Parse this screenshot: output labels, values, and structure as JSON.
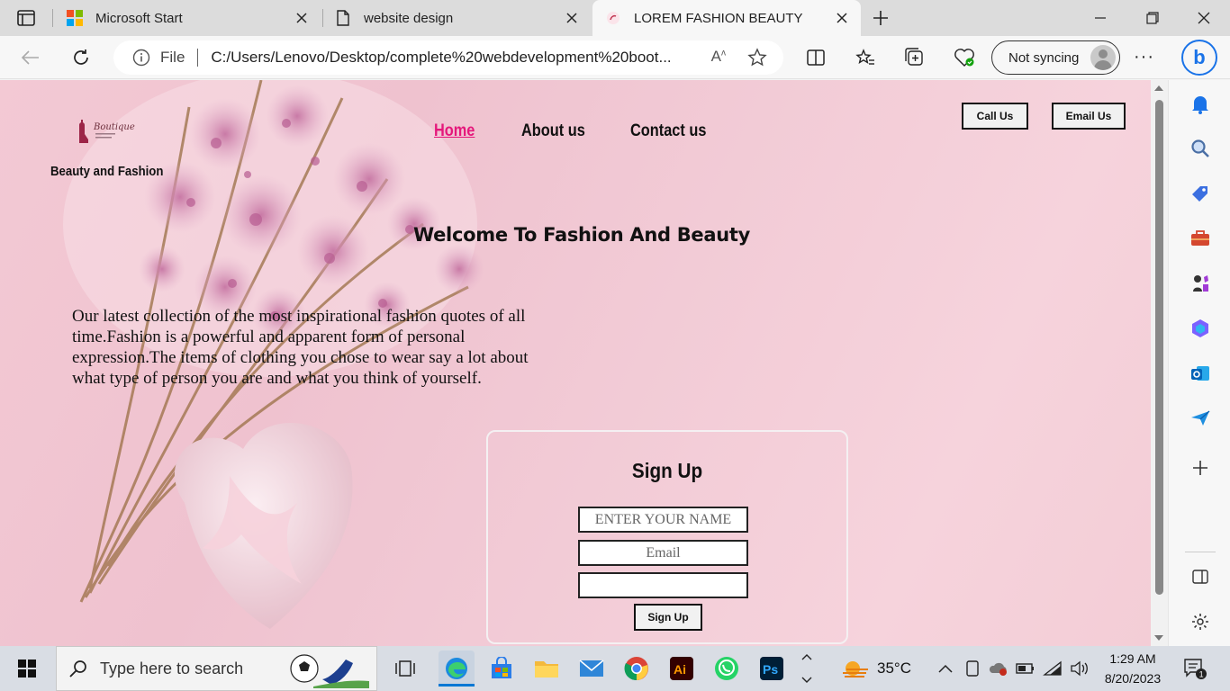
{
  "browser": {
    "tabs": [
      {
        "title": "Microsoft Start"
      },
      {
        "title": "website design"
      },
      {
        "title": "LOREM FASHION BEAUTY"
      }
    ],
    "address": {
      "scheme_label": "File",
      "url": "C:/Users/Lenovo/Desktop/complete%20webdevelopment%20boot...",
      "read_aloud": "Á⁾"
    },
    "sync_label": "Not syncing"
  },
  "page": {
    "brand_tagline": "Beauty and Fashion",
    "nav": [
      {
        "label": "Home",
        "active": true
      },
      {
        "label": "About us",
        "active": false
      },
      {
        "label": "Contact us",
        "active": false
      }
    ],
    "call_button": "Call Us",
    "email_button": "Email Us",
    "heading": "Welcome To Fashion And Beauty",
    "intro": "Our latest collection of the most inspirational fashion quotes of all time.Fashion is a powerful and apparent form of personal expression.The items of clothing you chose to wear say a lot about what type of person you are and what you think of yourself.",
    "signup": {
      "title": "Sign Up",
      "name_placeholder": "ENTER YOUR NAME",
      "email_placeholder": "Email",
      "third_placeholder": "",
      "button": "Sign Up"
    }
  },
  "taskbar": {
    "search_placeholder": "Type here to search",
    "weather": "35°C",
    "time": "1:29 AM",
    "date": "8/20/2023",
    "notification_count": "1"
  }
}
